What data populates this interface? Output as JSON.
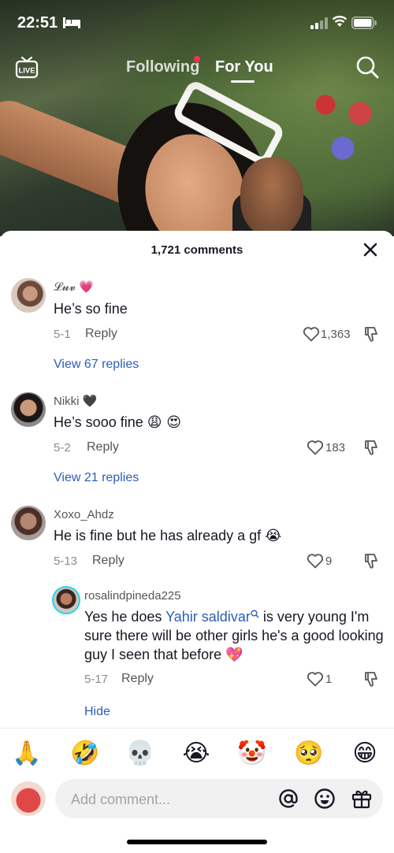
{
  "status_bar": {
    "time": "22:51"
  },
  "top_nav": {
    "live_label": "LIVE",
    "tabs": [
      {
        "label": "Following",
        "has_dot": true
      },
      {
        "label": "For You",
        "active": true
      }
    ]
  },
  "comments_sheet": {
    "title": "1,721 comments",
    "comments": [
      {
        "username": "𝓛𝓾𝓿",
        "username_emoji": "💗",
        "text": "He’s so fine",
        "date": "5-1",
        "reply_label": "Reply",
        "likes": "1,363",
        "view_replies": "View 67 replies"
      },
      {
        "username": "Nikki",
        "username_emoji": "🖤",
        "text": "He’s sooo fine",
        "text_emoji": "😩 😍",
        "date": "5-2",
        "reply_label": "Reply",
        "likes": "183",
        "view_replies": "View 21 replies"
      },
      {
        "username": "Xoxo_Ahdz",
        "text": "He is fine but he has already a gf",
        "text_emoji": "😭",
        "date": "5-13",
        "reply_label": "Reply",
        "likes": "9"
      }
    ],
    "reply": {
      "username": "rosalindpineda225",
      "text_before": "Yes he does ",
      "mention": "Yahir saldivar",
      "text_after": " is very young I'm sure there will be other girls he's a good looking guy I seen that before",
      "text_emoji": "💖",
      "date": "5-17",
      "reply_label": "Reply",
      "likes": "1",
      "hide_label": "Hide"
    }
  },
  "emoji_bar": [
    "🙏",
    "🤣",
    "💀",
    "😭",
    "🤡",
    "🥺",
    "😁"
  ],
  "input": {
    "placeholder": "Add comment..."
  },
  "colors": {
    "accent_red": "#fe2c55",
    "link_blue": "#2b5db9"
  }
}
